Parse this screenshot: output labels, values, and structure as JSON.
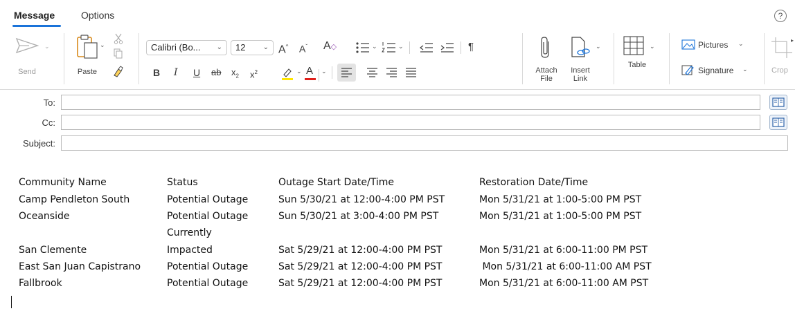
{
  "tabs": {
    "message": "Message",
    "options": "Options",
    "help": "?"
  },
  "ribbon": {
    "send_label": "Send",
    "paste_label": "Paste",
    "font_name": "Calibri (Bo...",
    "font_size": "12",
    "bold": "B",
    "italic": "I",
    "underline": "U",
    "strike": "ab",
    "subscript": "x",
    "superscript": "x",
    "sub_mark": "2",
    "sup_mark": "2",
    "pilcrow": "¶",
    "attach_label_1": "Attach",
    "attach_label_2": "File",
    "link_label_1": "Insert",
    "link_label_2": "Link",
    "table_label": "Table",
    "pictures_label": "Pictures",
    "signature_label": "Signature",
    "crop_label": "Crop",
    "colors": {
      "highlight": "#ffe600",
      "font_color": "#e0201b",
      "accent": "#1a73d9"
    }
  },
  "fields": {
    "to_label": "To:",
    "cc_label": "Cc:",
    "subject_label": "Subject:",
    "to_value": "",
    "cc_value": "",
    "subject_value": ""
  },
  "table": {
    "headers": [
      "Community Name",
      "Status",
      "Outage Start Date/Time",
      "Restoration Date/Time"
    ],
    "rows": [
      [
        "Camp Pendleton South",
        "Potential Outage",
        "Sun 5/30/21 at 12:00-4:00 PM PST",
        "Mon 5/31/21 at 1:00-5:00 PM PST"
      ],
      [
        "Oceanside",
        "Potential Outage",
        "Sun 5/30/21 at 3:00-4:00 PM PST",
        "Mon 5/31/21 at 1:00-5:00 PM PST"
      ],
      [
        "",
        "Currently",
        "",
        ""
      ],
      [
        "San Clemente",
        "Impacted",
        "Sat 5/29/21 at 12:00-4:00 PM PST",
        "Mon 5/31/21 at 6:00-11:00 PM PST"
      ],
      [
        "East San Juan Capistrano",
        "Potential Outage",
        "Sat 5/29/21 at 12:00-4:00 PM PST",
        " Mon 5/31/21 at 6:00-11:00 AM PST"
      ],
      [
        "Fallbrook",
        "Potential Outage",
        "Sat 5/29/21 at 12:00-4:00 PM PST",
        "Mon 5/31/21 at 6:00-11:00 AM PST"
      ]
    ]
  }
}
